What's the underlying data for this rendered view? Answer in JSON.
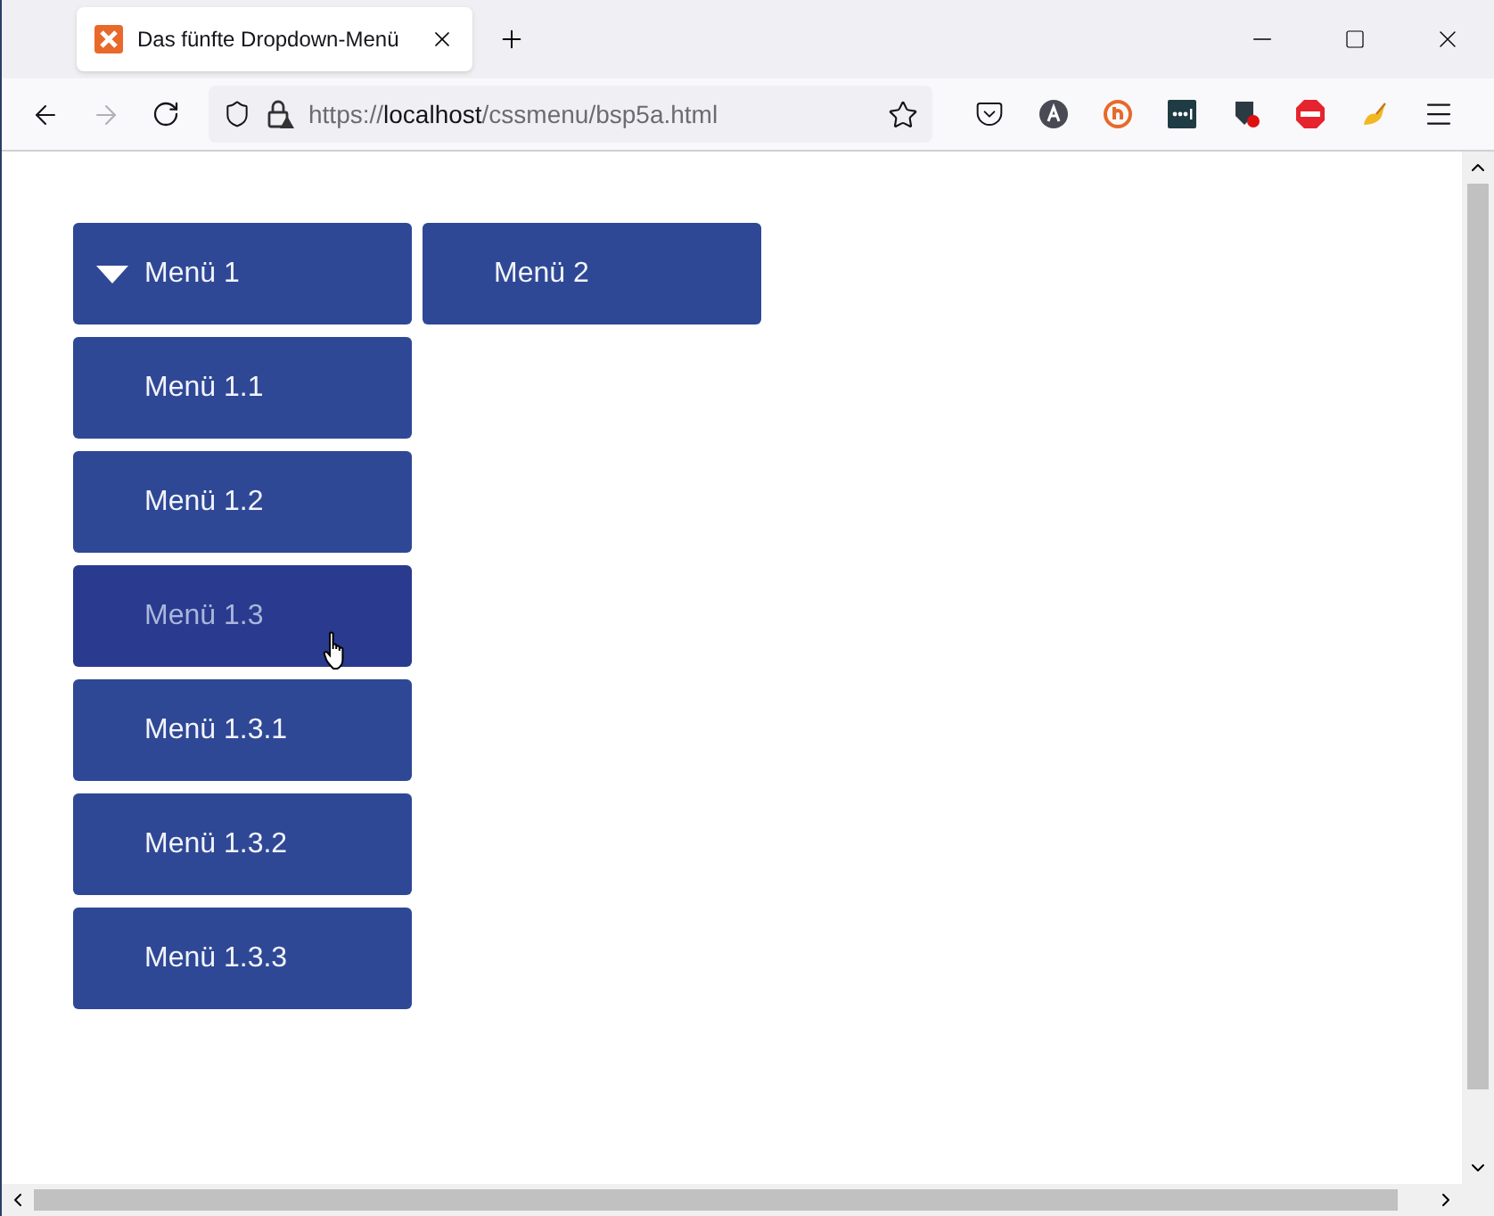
{
  "browser": {
    "tab": {
      "title": "Das fünfte Dropdown-Menü",
      "selected": true
    },
    "url": {
      "scheme": "https://",
      "host": "localhost",
      "path": "/cssmenu/bsp5a.html"
    }
  },
  "menu": [
    {
      "label": "Menü 1",
      "expanded": true,
      "selected": false,
      "children": [
        {
          "label": "Menü 1.1",
          "selected": false
        },
        {
          "label": "Menü 1.2",
          "selected": false
        },
        {
          "label": "Menü 1.3",
          "selected": true,
          "children": [
            {
              "label": "Menü 1.3.1",
              "selected": false
            },
            {
              "label": "Menü 1.3.2",
              "selected": false
            },
            {
              "label": "Menü 1.3.3",
              "selected": false
            }
          ]
        }
      ]
    },
    {
      "label": "Menü 2",
      "expanded": false,
      "selected": false
    }
  ]
}
